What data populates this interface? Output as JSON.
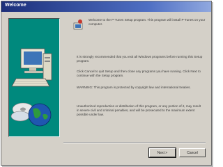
{
  "window": {
    "title": "Welcome"
  },
  "content": {
    "intro": "Welcome to the P-Tunes Setup program. This program will install P-Tunes on your computer.",
    "recommendation": "It is strongly recommended that you exit all Windows programs before running this Setup program.",
    "cancel_info": "Click Cancel to quit Setup and then close any programs you have running. Click Next to continue with the Setup program.",
    "warning": "WARNING: This program is protected by copyright law and international treaties.",
    "legal": "Unauthorized reproduction or distribution of this program, or any portion of it, may result in severe civil and criminal penalties, and will be prosecuted to the maximum extent possible under law."
  },
  "buttons": {
    "next_label": "Next >",
    "cancel_label": "Cancel"
  },
  "colors": {
    "panel": "#00897d",
    "titlebar": "#1c2f7a"
  }
}
